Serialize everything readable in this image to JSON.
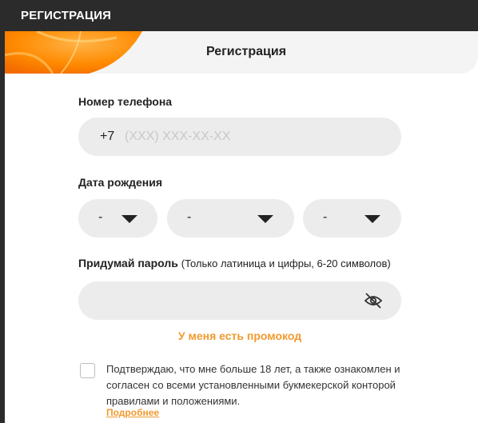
{
  "topbar": {
    "title": "РЕГИСТРАЦИЯ"
  },
  "header": {
    "title": "Регистрация"
  },
  "phone": {
    "label": "Номер телефона",
    "prefix": "+7",
    "placeholder": "(XXX) XXX-XX-XX",
    "value": ""
  },
  "birthdate": {
    "label": "Дата рождения",
    "day": "-",
    "month": "-",
    "year": "-"
  },
  "password": {
    "label": "Придумай пароль",
    "hint": "(Только латиница и цифры, 6-20 символов)",
    "value": "",
    "toggle_icon": "eye-slash-icon"
  },
  "promo": {
    "label": "У меня есть промокод"
  },
  "consent": {
    "checked": false,
    "text": "Подтверждаю, что мне больше 18 лет, а также ознакомлен и согласен со всеми установленными букмекерской конторой правилами и положениями.",
    "more_link": "Подробнее"
  },
  "colors": {
    "accent": "#f29a2e",
    "field_bg": "#ececec",
    "topbar_bg": "#2b2b2b",
    "header_bg": "#f4f4f4",
    "brand_orange": "#ff7a00"
  }
}
